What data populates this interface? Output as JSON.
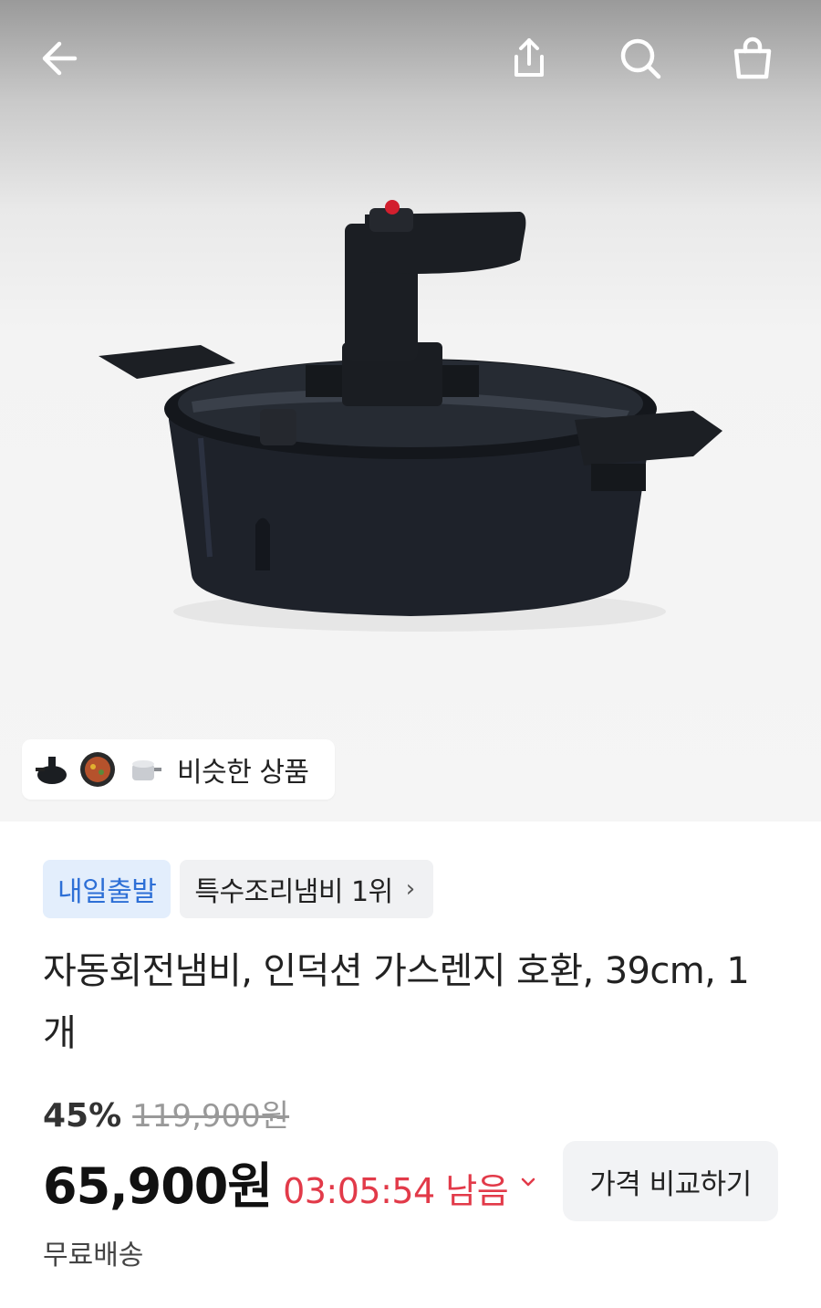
{
  "header": {
    "back_icon": "arrow-left-icon",
    "share_icon": "share-upload-icon",
    "search_icon": "search-icon",
    "cart_icon": "shopping-bag-icon"
  },
  "similar_products": {
    "label": "비슷한 상품",
    "thumbnails": [
      "pot-black-thumb",
      "pan-food-thumb",
      "stainless-pot-thumb"
    ]
  },
  "badges": {
    "delivery": "내일출발",
    "ranking": "특수조리냄비 1위"
  },
  "product": {
    "title": "자동회전냄비, 인덕션 가스렌지 호환, 39cm, 1개"
  },
  "pricing": {
    "discount": "45%",
    "original_price": "119,900원",
    "sale_price": "65,900원",
    "timer": "03:05:54 남음",
    "compare_button": "가격 비교하기"
  },
  "shipping": {
    "label": "무료배송"
  },
  "colors": {
    "accent_blue": "#2d6fd6",
    "badge_blue_bg": "#e3eefc",
    "timer_red": "#e23a49"
  }
}
